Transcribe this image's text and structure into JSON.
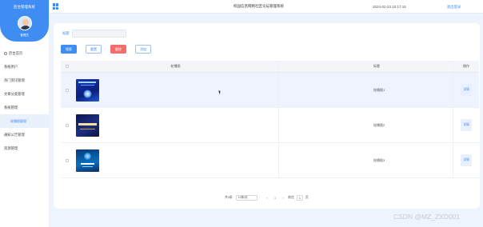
{
  "sidebar": {
    "title": "后台管理系统",
    "username": "管理员",
    "items": [
      {
        "label": "后台首页",
        "icon": "home-icon"
      },
      {
        "label": "系统用户"
      },
      {
        "label": "热门资讯管理"
      },
      {
        "label": "文章分类管理"
      },
      {
        "label": "系统管理"
      },
      {
        "label": "轮播图管理",
        "active": true
      },
      {
        "label": "通知公告管理"
      },
      {
        "label": "资源管理"
      }
    ]
  },
  "header": {
    "menu_icon": "grid-menu-icon",
    "title": "校园信息网络社区论坛管理系统",
    "datetime": "2024-02-23 10:17:15",
    "logout": "退出登录"
  },
  "search": {
    "label": "标题",
    "value": "",
    "placeholder": ""
  },
  "toolbar": {
    "search": "搜索",
    "reset": "重置",
    "delete": "删除",
    "add": "添加"
  },
  "table": {
    "headers": {
      "image": "轮播图",
      "title": "标题",
      "action": "操作"
    },
    "rows": [
      {
        "title": "轮播图1",
        "action": "详情"
      },
      {
        "title": "轮播图2",
        "action": "详情"
      },
      {
        "title": "轮播图3",
        "action": "详情"
      }
    ]
  },
  "pagination": {
    "total": "共3条",
    "page_size": "10条/页",
    "prev": "<",
    "current": "1",
    "next": ">",
    "goto_label": "前往",
    "goto_value": "1",
    "page_unit": "页"
  },
  "watermark": "CSDN @MZ_ZXD001"
}
